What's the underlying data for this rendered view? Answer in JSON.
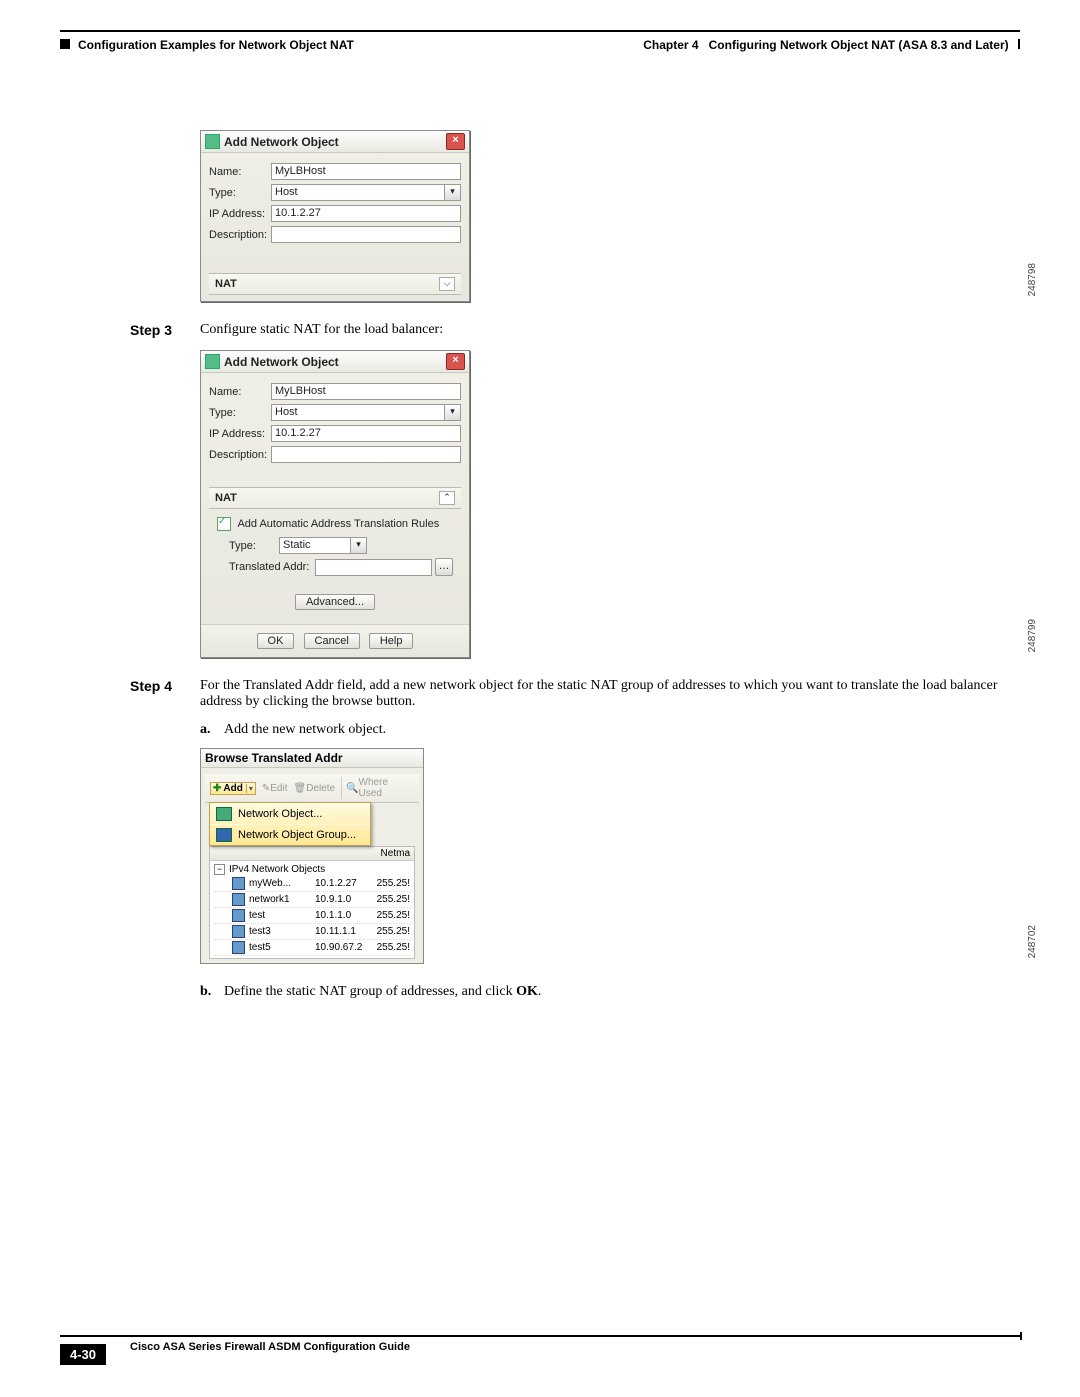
{
  "header": {
    "left": "Configuration Examples for Network Object NAT",
    "right_chapter": "Chapter 4",
    "right_title": "Configuring Network Object NAT (ASA 8.3 and Later)"
  },
  "step3": {
    "label": "Step 3",
    "text": "Configure static NAT for the load balancer:"
  },
  "step4": {
    "label": "Step 4",
    "text": "For the Translated Addr field, add a new network object for the static NAT group of addresses to which you want to translate the load balancer address by clicking the browse button."
  },
  "sub_a": {
    "label": "a.",
    "text": "Add the new network object."
  },
  "sub_b": {
    "label": "b.",
    "text_pre": "Define the static NAT group of addresses, and click ",
    "ok": "OK",
    "text_post": "."
  },
  "dialog1": {
    "title": "Add Network Object",
    "name_lbl": "Name:",
    "name_val": "MyLBHost",
    "type_lbl": "Type:",
    "type_val": "Host",
    "ip_lbl": "IP Address:",
    "ip_val": "10.1.2.27",
    "desc_lbl": "Description:",
    "desc_val": "",
    "nat_label": "NAT",
    "side_id": "248798"
  },
  "dialog2": {
    "title": "Add Network Object",
    "name_lbl": "Name:",
    "name_val": "MyLBHost",
    "type_lbl": "Type:",
    "type_val": "Host",
    "ip_lbl": "IP Address:",
    "ip_val": "10.1.2.27",
    "desc_lbl": "Description:",
    "desc_val": "",
    "nat_label": "NAT",
    "add_auto": "Add Automatic Address Translation Rules",
    "nat_type_lbl": "Type:",
    "nat_type_val": "Static",
    "trans_lbl": "Translated Addr:",
    "trans_val": "",
    "advanced": "Advanced...",
    "ok": "OK",
    "cancel": "Cancel",
    "help": "Help",
    "side_id": "248799"
  },
  "browse": {
    "title": "Browse Translated Addr",
    "add": "Add",
    "edit": "Edit",
    "delete": "Delete",
    "where": "Where Used",
    "menu_obj": "Network Object...",
    "menu_grp": "Network Object Group...",
    "col_netmask": "Netma",
    "tree_root": "IPv4 Network Objects",
    "rows": [
      {
        "name": "myWeb...",
        "ip": "10.1.2.27",
        "nm": "255.25!"
      },
      {
        "name": "network1",
        "ip": "10.9.1.0",
        "nm": "255.25!"
      },
      {
        "name": "test",
        "ip": "10.1.1.0",
        "nm": "255.25!"
      },
      {
        "name": "test3",
        "ip": "10.11.1.1",
        "nm": "255.25!"
      },
      {
        "name": "test5",
        "ip": "10.90.67.2",
        "nm": "255.25!"
      }
    ],
    "side_id": "248702"
  },
  "footer": {
    "guide": "Cisco ASA Series Firewall ASDM Configuration Guide",
    "pagenum": "4-30"
  }
}
